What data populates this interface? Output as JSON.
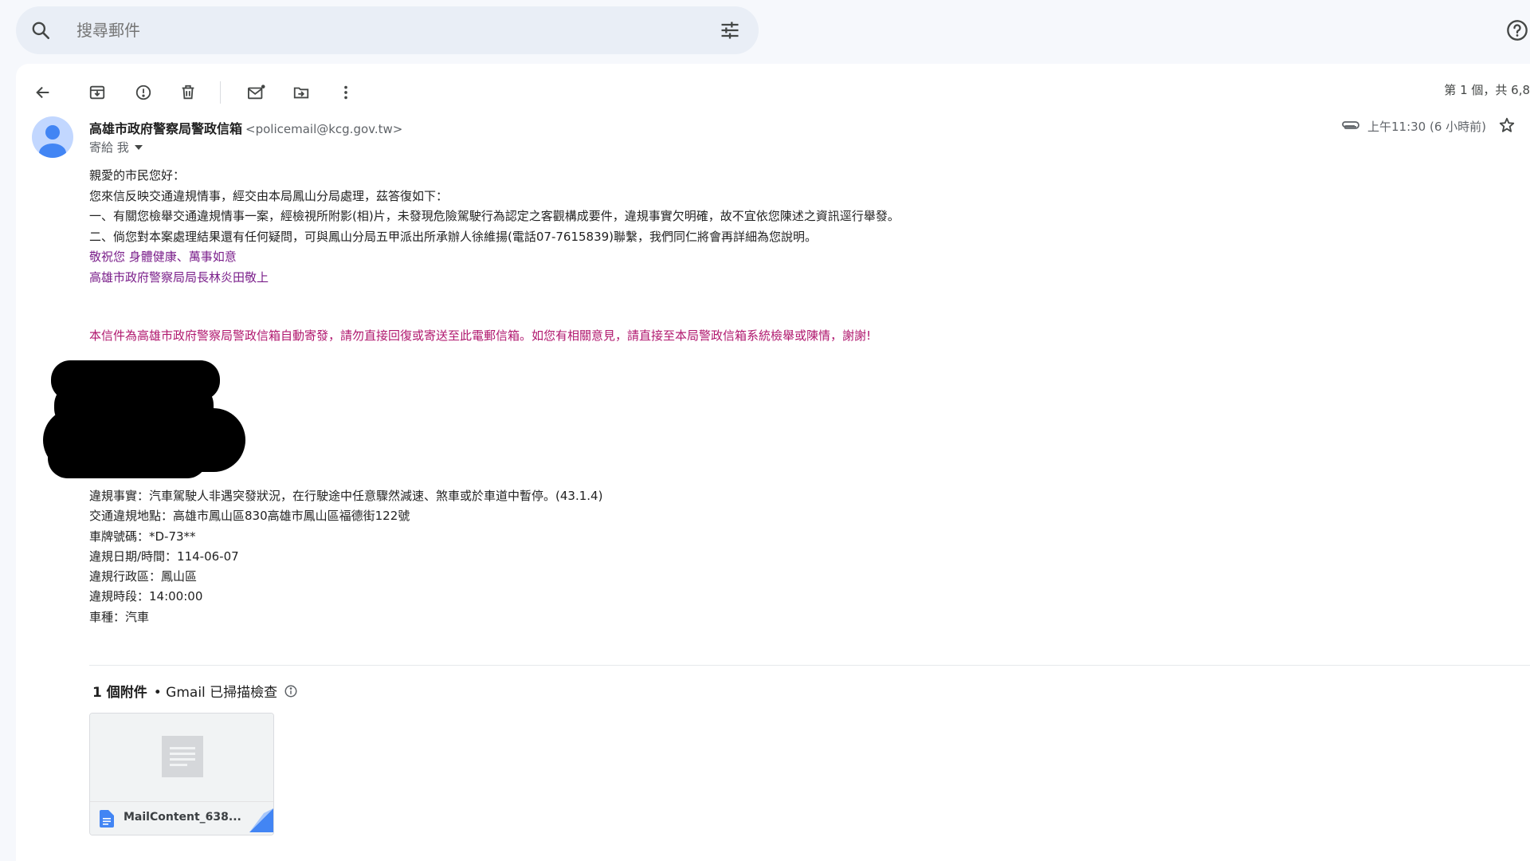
{
  "search": {
    "placeholder": "搜尋郵件",
    "icons": [
      "search-icon",
      "filter-options-icon"
    ]
  },
  "help_icon": "help-icon",
  "toolbar": {
    "icons": [
      "back-arrow-icon",
      "archive-icon",
      "report-spam-icon",
      "delete-icon",
      "mark-unread-icon",
      "move-to-icon",
      "more-options-icon"
    ],
    "pager": "第 1 個，共 6,8"
  },
  "message": {
    "sender_name": "高雄市政府警察局警政信箱",
    "sender_email": "<policemail@kcg.gov.tw>",
    "recipient": "寄給 我",
    "time": "上午11:30 (6 小時前)",
    "greeting": "親愛的市民您好：",
    "lines": [
      "您來信反映交通違規情事，經交由本局鳳山分局處理，茲答復如下：",
      "一、有關您檢舉交通違規情事一案，經檢視所附影(相)片，未發現危險駕駛行為認定之客觀構成要件，違規事實欠明確，故不宜依您陳述之資訊逕行舉發。",
      "二、倘您對本案處理結果還有任何疑問，可與鳳山分局五甲派出所承辦人徐維揚(電話07-7615839)聯繫，我們同仁將會再詳細為您說明。"
    ],
    "closing": "敬祝您 身體健康、萬事如意",
    "signature": "高雄市政府警察局局長林炎田敬上",
    "auto_notice": "本信件為高雄市政府警察局警政信箱自動寄發，請勿直接回復或寄送至此電郵信箱。如您有相關意見，請直接至本局警政信箱系統檢舉或陳情，謝謝!",
    "details": [
      "違規事實：汽車駕駛人非遇突發狀況，在行駛途中任意驟然減速、煞車或於車道中暫停。(43.1.4)",
      "交通違規地點：高雄市鳳山區830高雄市鳳山區福德街122號",
      "車牌號碼：*D-73**",
      "違規日期/時間：114-06-07",
      "違規行政區：鳳山區",
      "違規時段：14:00:00",
      "車種：汽車"
    ]
  },
  "attachments": {
    "count_label": "1 個附件",
    "scan_label": "• Gmail 已掃描檢查",
    "files": [
      {
        "name": "MailContent_638..."
      }
    ]
  },
  "colors": {
    "page_bg": "#f6f8fc",
    "search_bg": "#e9eef6",
    "signature_purple": "#7a1e8a",
    "notice_magenta": "#b0176e",
    "avatar_blue": "#4285f4"
  }
}
